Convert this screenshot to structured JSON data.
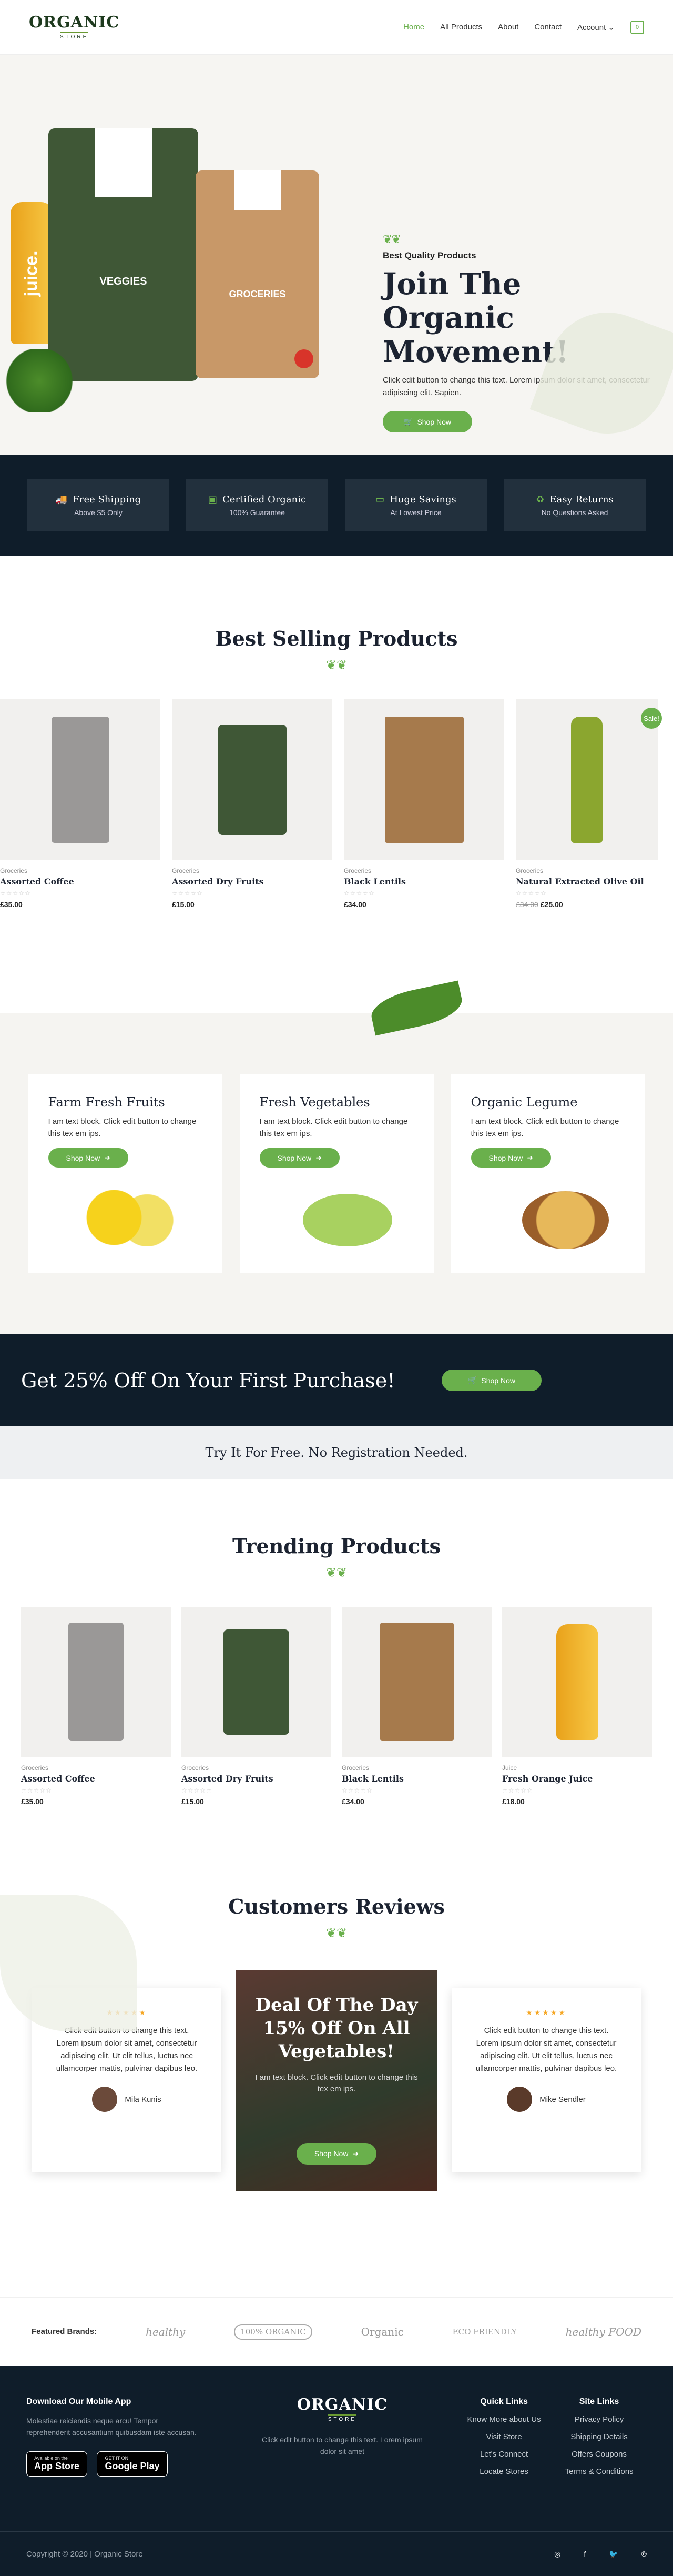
{
  "header": {
    "logo_main": "ORGANIC",
    "logo_sub": "STORE",
    "nav": [
      "Home",
      "All Products",
      "About",
      "Contact",
      "Account"
    ],
    "cart_count": "0"
  },
  "hero": {
    "kicker": "Best Quality Products",
    "title": "Join The Organic Movement!",
    "description": "Click edit button to change this text. Lorem ipsum dolor sit amet, consectetur adipiscing elit. Sapien.",
    "button": "Shop Now",
    "bag_left_label": "VEGGIES",
    "bag_right_label": "GROCERIES",
    "bottle_label": "juice."
  },
  "features": [
    {
      "title": "Free Shipping",
      "sub": "Above $5 Only",
      "icon": "truck-icon"
    },
    {
      "title": "Certified Organic",
      "sub": "100% Guarantee",
      "icon": "certificate-icon"
    },
    {
      "title": "Huge Savings",
      "sub": "At Lowest Price",
      "icon": "money-icon"
    },
    {
      "title": "Easy Returns",
      "sub": "No Questions Asked",
      "icon": "recycle-icon"
    }
  ],
  "best_selling": {
    "title": "Best Selling Products",
    "sale_badge": "Sale!",
    "items": [
      {
        "category": "Groceries",
        "name": "Assorted Coffee",
        "price": "£35.00",
        "old_price": ""
      },
      {
        "category": "Groceries",
        "name": "Assorted Dry Fruits",
        "price": "£15.00",
        "old_price": ""
      },
      {
        "category": "Groceries",
        "name": "Black Lentils",
        "price": "£34.00",
        "old_price": ""
      },
      {
        "category": "Groceries",
        "name": "Natural Extracted Olive Oil",
        "price": "£25.00",
        "old_price": "£34.00"
      }
    ]
  },
  "categories": [
    {
      "title": "Farm Fresh Fruits",
      "text": "I am text block. Click edit button to change this tex em ips.",
      "button": "Shop Now"
    },
    {
      "title": "Fresh Vegetables",
      "text": "I am text block. Click edit button to change this tex em ips.",
      "button": "Shop Now"
    },
    {
      "title": "Organic Legume",
      "text": "I am text block. Click edit button to change this tex em ips.",
      "button": "Shop Now"
    }
  ],
  "promo": {
    "title": "Get 25% Off On Your First Purchase!",
    "button": "Shop Now",
    "try_text": "Try It For Free. No Registration Needed."
  },
  "trending": {
    "title": "Trending Products",
    "items": [
      {
        "category": "Groceries",
        "name": "Assorted Coffee",
        "price": "£35.00"
      },
      {
        "category": "Groceries",
        "name": "Assorted Dry Fruits",
        "price": "£15.00"
      },
      {
        "category": "Groceries",
        "name": "Black Lentils",
        "price": "£34.00"
      },
      {
        "category": "Juice",
        "name": "Fresh Orange Juice",
        "price": "£18.00"
      }
    ]
  },
  "reviews": {
    "title": "Customers Reviews",
    "left": {
      "text": "Click edit button to change this text. Lorem ipsum dolor sit amet, consectetur adipiscing elit. Ut elit tellus, luctus nec ullamcorper mattis, pulvinar dapibus leo.",
      "name": "Mila Kunis"
    },
    "right": {
      "text": "Click edit button to change this text. Lorem ipsum dolor sit amet, consectetur adipiscing elit. Ut elit tellus, luctus nec ullamcorper mattis, pulvinar dapibus leo.",
      "name": "Mike Sendler"
    },
    "deal": {
      "title": "Deal Of The Day 15% Off On All Vegetables!",
      "text": "I am text block. Click edit button to change this tex em ips.",
      "button": "Shop Now"
    }
  },
  "brands": {
    "label": "Featured Brands:",
    "items": [
      "healthy",
      "100% ORGANIC",
      "Organic",
      "ECO FRIENDLY",
      "healthy FOOD"
    ]
  },
  "footer": {
    "app_title": "Download Our Mobile App",
    "app_text": "Molestiae reiciendis neque arcu! Tempor reprehenderit accusantium quibusdam iste accusan.",
    "appstore_small": "Available on the",
    "appstore": "App Store",
    "gplay_small": "GET IT ON",
    "gplay": "Google Play",
    "center_text": "Click edit button to change this text. Lorem ipsum dolor sit amet",
    "quick_title": "Quick Links",
    "quick_links": [
      "Know More about Us",
      "Visit Store",
      "Let's Connect",
      "Locate Stores"
    ],
    "site_title": "Site Links",
    "site_links": [
      "Privacy Policy",
      "Shipping Details",
      "Offers Coupons",
      "Terms & Conditions"
    ],
    "copyright": "Copyright © 2020 | Organic Store"
  },
  "colors": {
    "accent": "#6ab04c",
    "dark": "#0f1d2a",
    "star": "#f5a623"
  }
}
